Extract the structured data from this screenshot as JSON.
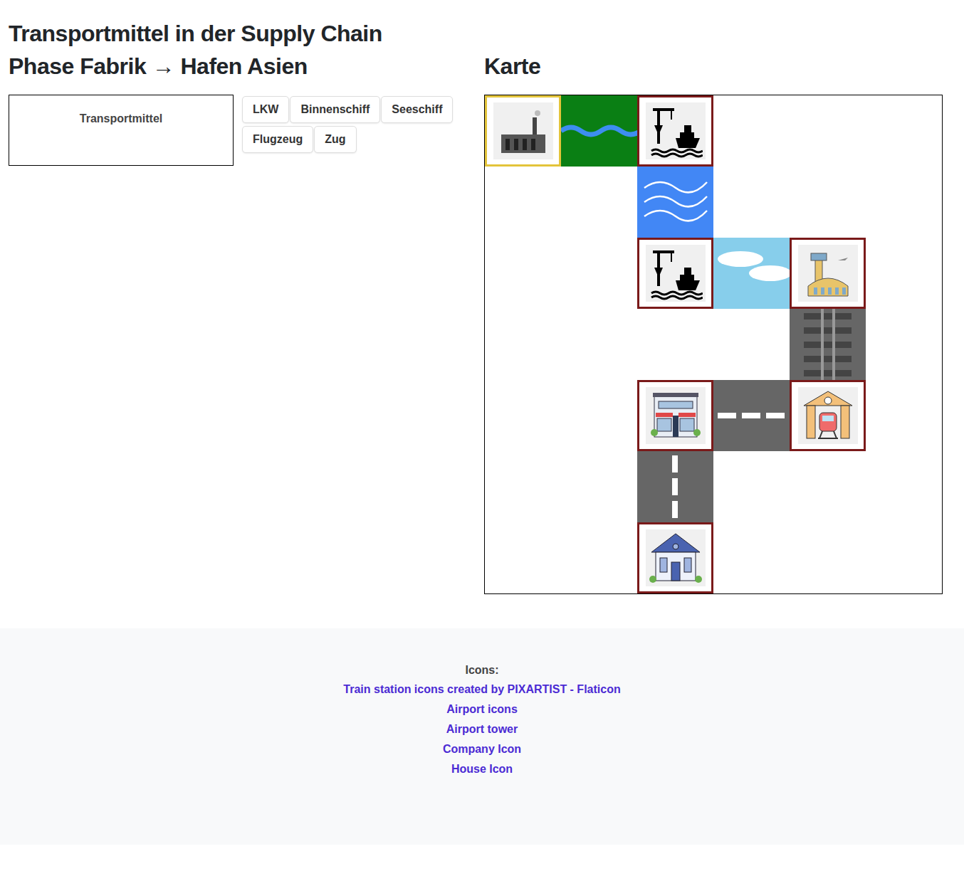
{
  "page": {
    "title": "Transportmittel in der Supply Chain"
  },
  "phase": {
    "title": "Phase Fabrik → Hafen Asien",
    "dropzone": {
      "label": "Transportmittel"
    },
    "buttons": [
      "LKW",
      "Binnenschiff",
      "Seeschiff",
      "Flugzeug",
      "Zug"
    ]
  },
  "map": {
    "title": "Karte",
    "rows": [
      [
        {
          "kind": "factory",
          "active": true
        },
        {
          "kind": "river",
          "active": false
        },
        {
          "kind": "port",
          "active": false
        },
        {
          "kind": "empty",
          "active": false
        },
        {
          "kind": "empty",
          "active": false
        },
        {
          "kind": "empty",
          "active": false
        }
      ],
      [
        {
          "kind": "empty",
          "active": false
        },
        {
          "kind": "empty",
          "active": false
        },
        {
          "kind": "sea",
          "active": false
        },
        {
          "kind": "empty",
          "active": false
        },
        {
          "kind": "empty",
          "active": false
        },
        {
          "kind": "empty",
          "active": false
        }
      ],
      [
        {
          "kind": "empty",
          "active": false
        },
        {
          "kind": "empty",
          "active": false
        },
        {
          "kind": "port",
          "active": false
        },
        {
          "kind": "air",
          "active": false
        },
        {
          "kind": "airport",
          "active": false
        },
        {
          "kind": "empty",
          "active": false
        }
      ],
      [
        {
          "kind": "empty",
          "active": false
        },
        {
          "kind": "empty",
          "active": false
        },
        {
          "kind": "empty",
          "active": false
        },
        {
          "kind": "empty",
          "active": false
        },
        {
          "kind": "rail",
          "active": false
        },
        {
          "kind": "empty",
          "active": false
        }
      ],
      [
        {
          "kind": "empty",
          "active": false
        },
        {
          "kind": "empty",
          "active": false
        },
        {
          "kind": "shop",
          "active": false
        },
        {
          "kind": "road-h",
          "active": false
        },
        {
          "kind": "station",
          "active": false
        },
        {
          "kind": "empty",
          "active": false
        }
      ],
      [
        {
          "kind": "empty",
          "active": false
        },
        {
          "kind": "empty",
          "active": false
        },
        {
          "kind": "road-v",
          "active": false
        },
        {
          "kind": "empty",
          "active": false
        },
        {
          "kind": "empty",
          "active": false
        },
        {
          "kind": "empty",
          "active": false
        }
      ],
      [
        {
          "kind": "empty",
          "active": false
        },
        {
          "kind": "empty",
          "active": false
        },
        {
          "kind": "house",
          "active": false
        },
        {
          "kind": "empty",
          "active": false
        },
        {
          "kind": "empty",
          "active": false
        },
        {
          "kind": "empty",
          "active": false
        }
      ]
    ]
  },
  "footer": {
    "label": "Icons:",
    "links": [
      "Train station icons created by PIXARTIST - Flaticon",
      "Airport icons",
      "Airport tower",
      "Company Icon",
      "House Icon"
    ]
  }
}
